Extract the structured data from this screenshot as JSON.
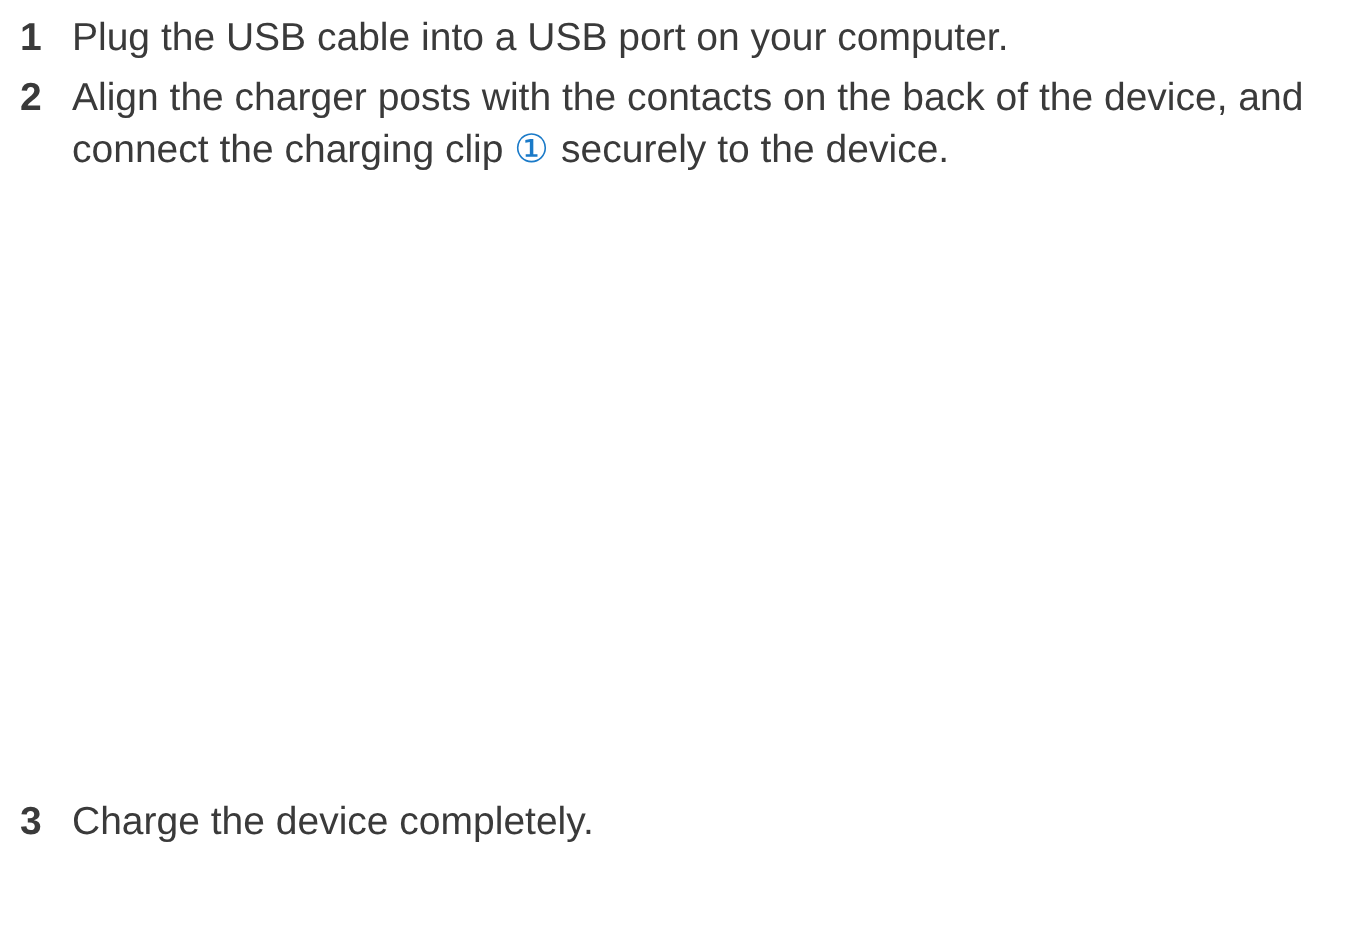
{
  "steps": [
    {
      "number": "1",
      "segments": [
        {
          "kind": "text",
          "text": "Plug the USB cable into a USB port on your computer."
        }
      ]
    },
    {
      "number": "2",
      "segments": [
        {
          "kind": "text",
          "text": "Align the charger posts with the contacts on the back of the device, and connect the charging clip "
        },
        {
          "kind": "callout",
          "text": "①"
        },
        {
          "kind": "text",
          "text": " securely to the device."
        }
      ]
    },
    {
      "number": "3",
      "segments": [
        {
          "kind": "text",
          "text": "Charge the device completely."
        }
      ]
    }
  ]
}
